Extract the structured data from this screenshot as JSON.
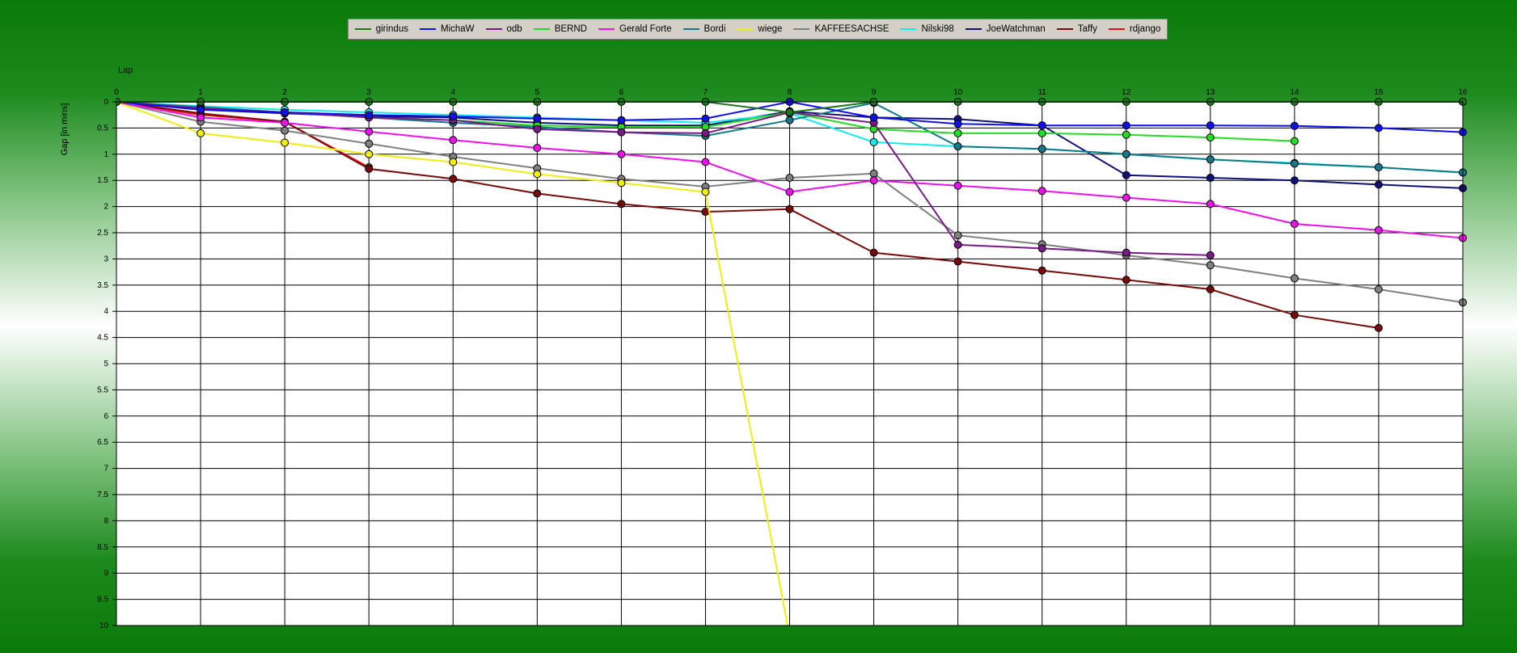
{
  "chart_data": {
    "type": "line",
    "xlabel": "Lap",
    "ylabel": "Gap [in mins]",
    "x": [
      0,
      1,
      2,
      3,
      4,
      5,
      6,
      7,
      8,
      9,
      10,
      11,
      12,
      13,
      14,
      15,
      16
    ],
    "xlim": [
      0,
      16
    ],
    "ylim": [
      10,
      0
    ],
    "y_inverted": true,
    "y_ticks": [
      "0",
      "0.5",
      "1",
      "1.5",
      "2",
      "2.5",
      "3",
      "3.5",
      "4",
      "4.5",
      "5",
      "5.5",
      "6",
      "6.5",
      "7",
      "7.5",
      "8",
      "8.5",
      "9",
      "9.5",
      "10"
    ],
    "grid": true,
    "legend_position": "top",
    "plot_background": "#ffffff",
    "series": [
      {
        "name": "girindus",
        "color": "#1a7a1a",
        "values": [
          0,
          0,
          0,
          0,
          0,
          0,
          0,
          0,
          0.2,
          0,
          0,
          0,
          0,
          0,
          0,
          0,
          0
        ]
      },
      {
        "name": "MichaW",
        "color": "#1010ee",
        "values": [
          0,
          0.15,
          0.2,
          0.25,
          0.28,
          0.32,
          0.35,
          0.32,
          0,
          0.3,
          0.42,
          0.45,
          0.45,
          0.45,
          0.46,
          0.5,
          0.58
        ]
      },
      {
        "name": "odb",
        "color": "#7a1a8a",
        "values": [
          0,
          0.12,
          0.2,
          0.3,
          0.35,
          0.52,
          0.58,
          0.6,
          0.2,
          0.4,
          2.73,
          2.8,
          2.88,
          2.93,
          null,
          null,
          null
        ]
      },
      {
        "name": "BERND",
        "color": "#22dd22",
        "values": [
          0,
          0.12,
          0.2,
          0.3,
          0.35,
          0.45,
          0.48,
          0.48,
          0.2,
          0.52,
          0.6,
          0.6,
          0.63,
          0.68,
          0.75,
          null,
          null
        ]
      },
      {
        "name": "Gerald Forte",
        "color": "#ee10ee",
        "values": [
          0,
          0.3,
          0.4,
          0.57,
          0.73,
          0.88,
          1.0,
          1.15,
          1.72,
          1.5,
          1.6,
          1.7,
          1.83,
          1.95,
          2.33,
          2.45,
          2.6
        ]
      },
      {
        "name": "Bordi",
        "color": "#107a8a",
        "values": [
          0,
          0.1,
          0.2,
          0.3,
          0.4,
          0.48,
          0.58,
          0.65,
          0.35,
          0.02,
          0.85,
          0.9,
          1.0,
          1.1,
          1.18,
          1.25,
          1.35
        ]
      },
      {
        "name": "wiege",
        "color": "#eeee10",
        "values": [
          0,
          0.6,
          0.78,
          1.0,
          1.15,
          1.38,
          1.55,
          1.72,
          10.2,
          null,
          null,
          null,
          null,
          null,
          null,
          null,
          null
        ]
      },
      {
        "name": "KAFFEESACHSE",
        "color": "#808080",
        "values": [
          0,
          0.38,
          0.55,
          0.8,
          1.05,
          1.27,
          1.47,
          1.62,
          1.45,
          1.37,
          2.55,
          2.72,
          2.93,
          3.12,
          3.37,
          3.58,
          3.83
        ]
      },
      {
        "name": "Nilski98",
        "color": "#10eeee",
        "values": [
          0,
          0.08,
          0.15,
          0.2,
          0.25,
          0.3,
          0.35,
          0.4,
          0.22,
          0.77,
          0.85,
          0.9,
          1.0,
          1.1,
          1.17,
          1.25,
          1.35
        ]
      },
      {
        "name": "JoeWatchman",
        "color": "#10107a",
        "values": [
          0,
          0.15,
          0.22,
          0.28,
          0.3,
          0.4,
          0.45,
          0.45,
          0.18,
          0.3,
          0.33,
          0.45,
          1.4,
          1.45,
          1.5,
          1.58,
          1.65
        ]
      },
      {
        "name": "Taffy",
        "color": "#7a0a0a",
        "values": [
          0,
          0.22,
          0.38,
          1.28,
          1.47,
          1.75,
          1.95,
          2.1,
          2.05,
          2.88,
          3.05,
          3.22,
          3.4,
          3.58,
          4.07,
          4.32,
          null
        ]
      },
      {
        "name": "rdjango",
        "color": "#ee1010",
        "values": [
          0,
          0.25,
          0.38,
          1.25,
          null,
          null,
          null,
          null,
          null,
          null,
          null,
          null,
          null,
          null,
          null,
          null,
          null
        ]
      }
    ]
  }
}
